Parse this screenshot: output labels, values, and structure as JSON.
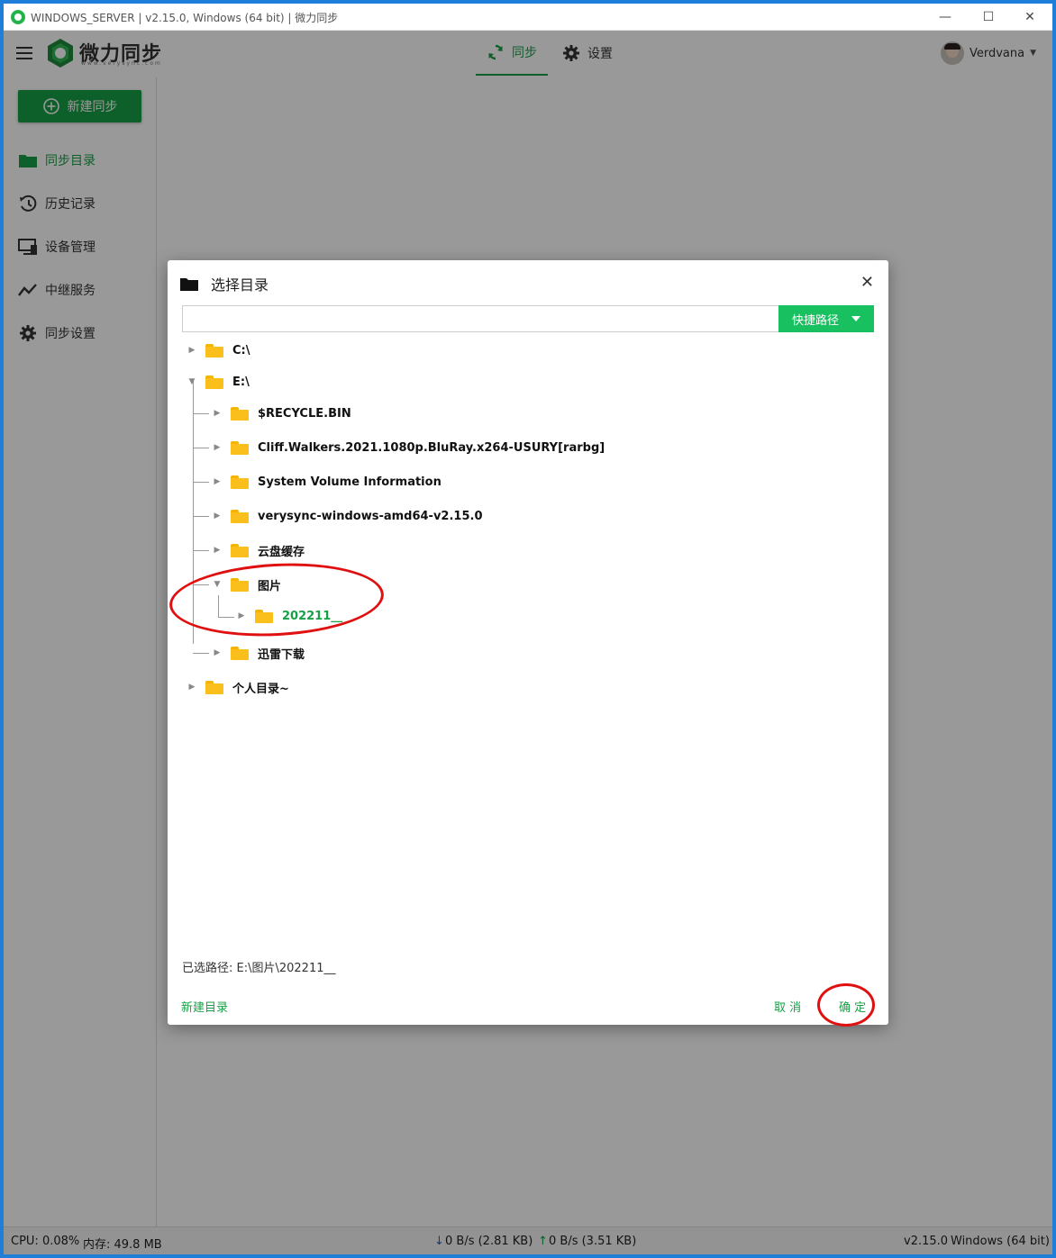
{
  "window": {
    "title": "WINDOWS_SERVER | v2.15.0, Windows (64 bit) | 微力同步"
  },
  "header": {
    "logo_text": "微力同步",
    "logo_sub": "www.verysync.com",
    "tabs": [
      {
        "label": "同步",
        "active": true
      },
      {
        "label": "设置",
        "active": false
      }
    ],
    "user": "Verdvana"
  },
  "sidebar": {
    "new_button": "新建同步",
    "items": [
      {
        "label": "同步目录",
        "icon": "folder-icon",
        "active": true
      },
      {
        "label": "历史记录",
        "icon": "history-icon",
        "active": false
      },
      {
        "label": "设备管理",
        "icon": "devices-icon",
        "active": false
      },
      {
        "label": "中继服务",
        "icon": "relay-icon",
        "active": false
      },
      {
        "label": "同步设置",
        "icon": "gear-icon",
        "active": false
      }
    ]
  },
  "dialog": {
    "title": "选择目录",
    "path_value": "",
    "quick_path": "快捷路径",
    "tree": [
      {
        "label": "C:\\",
        "depth": 0,
        "expanded": false
      },
      {
        "label": "E:\\",
        "depth": 0,
        "expanded": true
      },
      {
        "label": "$RECYCLE.BIN",
        "depth": 1,
        "expanded": false
      },
      {
        "label": "Cliff.Walkers.2021.1080p.BluRay.x264-USURY[rarbg]",
        "depth": 1,
        "expanded": false
      },
      {
        "label": "System Volume Information",
        "depth": 1,
        "expanded": false
      },
      {
        "label": "verysync-windows-amd64-v2.15.0",
        "depth": 1,
        "expanded": false
      },
      {
        "label": "云盘缓存",
        "depth": 1,
        "expanded": false
      },
      {
        "label": "图片",
        "depth": 1,
        "expanded": true
      },
      {
        "label": "202211__",
        "depth": 2,
        "expanded": false,
        "selected": true
      },
      {
        "label": "迅雷下载",
        "depth": 1,
        "expanded": false
      },
      {
        "label": "个人目录~",
        "depth": 0,
        "expanded": false
      }
    ],
    "selected_path": "已选路径: E:\\图片\\202211__",
    "new_folder": "新建目录",
    "cancel": "取 消",
    "confirm": "确 定"
  },
  "status": {
    "cpu": "CPU: 0.08%",
    "mem": "内存: 49.8 MB",
    "down": "0 B/s (2.81 KB)",
    "up": "0 B/s (3.51 KB)",
    "version": "v2.15.0",
    "os": "Windows (64 bit)"
  },
  "colors": {
    "accent": "#18a046",
    "button": "#18c060",
    "annotation": "#e01010"
  }
}
